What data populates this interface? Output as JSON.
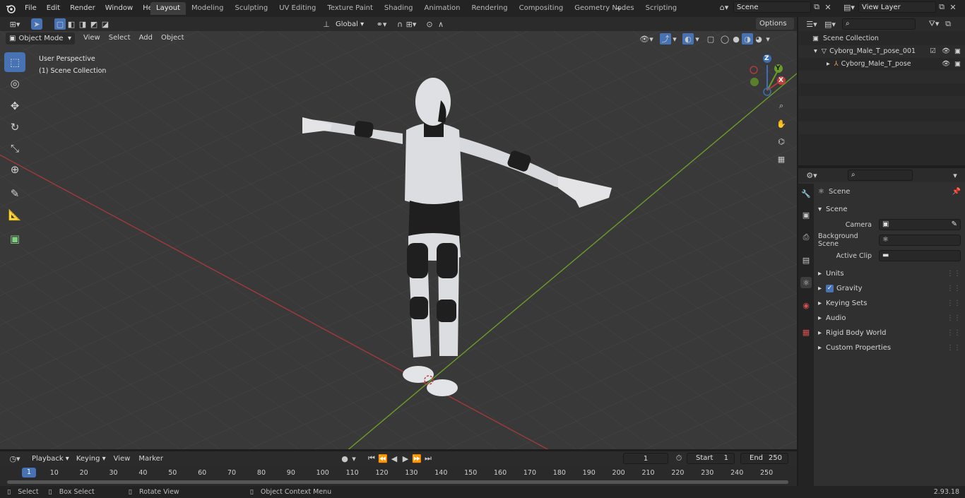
{
  "app": {
    "version": "2.93.18"
  },
  "menus": [
    "File",
    "Edit",
    "Render",
    "Window",
    "Help"
  ],
  "workspaces": [
    "Layout",
    "Modeling",
    "Sculpting",
    "UV Editing",
    "Texture Paint",
    "Shading",
    "Animation",
    "Rendering",
    "Compositing",
    "Geometry Nodes",
    "Scripting"
  ],
  "scene_name": "Scene",
  "view_layer": "View Layer",
  "header": {
    "mode": "Object Mode",
    "view": "View",
    "select": "Select",
    "add": "Add",
    "object": "Object",
    "orientation": "Global",
    "options": "Options"
  },
  "viewport": {
    "perspective": "User Perspective",
    "collection": "(1) Scene Collection",
    "gizmo_z": "Z",
    "gizmo_y": "Y",
    "gizmo_x": "X"
  },
  "outliner": {
    "root": "Scene Collection",
    "items": [
      {
        "label": "Cyborg_Male_T_pose_001"
      },
      {
        "label": "Cyborg_Male_T_pose"
      }
    ]
  },
  "properties": {
    "context": "Scene",
    "panel_title": "Scene",
    "camera_label": "Camera",
    "background_label": "Background Scene",
    "clip_label": "Active Clip",
    "panels": [
      "Units",
      "Gravity",
      "Keying Sets",
      "Audio",
      "Rigid Body World",
      "Custom Properties"
    ]
  },
  "timeline": {
    "playback": "Playback",
    "keying": "Keying",
    "view": "View",
    "marker": "Marker",
    "current_frame": "1",
    "start_label": "Start",
    "start": "1",
    "end_label": "End",
    "end": "250",
    "ticks": [
      "1",
      "10",
      "20",
      "30",
      "40",
      "50",
      "60",
      "70",
      "80",
      "90",
      "100",
      "110",
      "120",
      "130",
      "140",
      "150",
      "160",
      "170",
      "180",
      "190",
      "200",
      "210",
      "220",
      "230",
      "240",
      "250"
    ]
  },
  "status": {
    "select": "Select",
    "box_select": "Box Select",
    "rotate_view": "Rotate View",
    "context_menu": "Object Context Menu"
  },
  "colors": {
    "accent": "#4772b3",
    "x_axis": "#b03a3a",
    "y_axis": "#6a9b2a",
    "viewport_bg": "#393939"
  }
}
